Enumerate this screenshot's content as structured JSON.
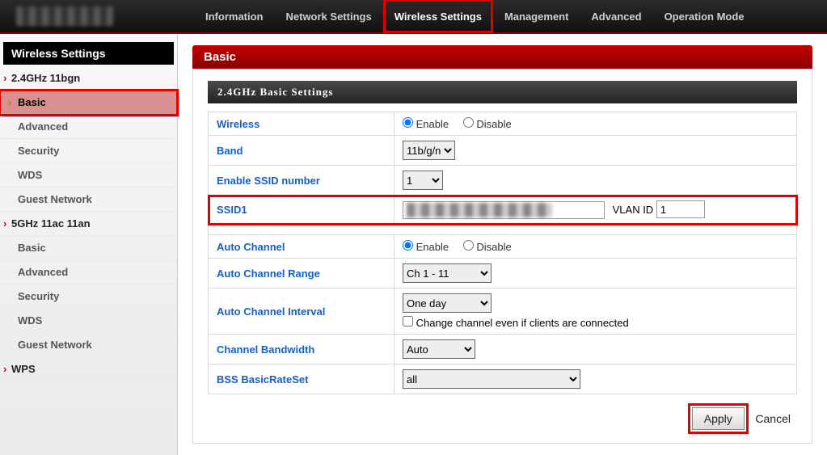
{
  "nav": {
    "items": [
      "Information",
      "Network Settings",
      "Wireless Settings",
      "Management",
      "Advanced",
      "Operation Mode"
    ],
    "activeIndex": 2
  },
  "sidebar": {
    "title": "Wireless Settings",
    "groups": [
      {
        "parent": "2.4GHz 11bgn",
        "items": [
          "Basic",
          "Advanced",
          "Security",
          "WDS",
          "Guest Network"
        ],
        "selectedIndex": 0
      },
      {
        "parent": "5GHz 11ac 11an",
        "items": [
          "Basic",
          "Advanced",
          "Security",
          "WDS",
          "Guest Network"
        ]
      },
      {
        "parent": "WPS",
        "items": []
      }
    ]
  },
  "panel": {
    "title": "Basic",
    "section": "2.4GHz Basic Settings"
  },
  "form": {
    "wireless_label": "Wireless",
    "enable_label": "Enable",
    "disable_label": "Disable",
    "band_label": "Band",
    "band_value": "11b/g/n",
    "enable_ssid_label": "Enable SSID number",
    "enable_ssid_value": "1",
    "ssid1_label": "SSID1",
    "ssid1_value": "",
    "vlan_label": "VLAN ID",
    "vlan_value": "1",
    "auto_channel_label": "Auto Channel",
    "auto_channel_range_label": "Auto Channel Range",
    "auto_channel_range_value": "Ch 1 - 11",
    "auto_channel_interval_label": "Auto Channel Interval",
    "auto_channel_interval_value": "One day",
    "change_channel_label": "Change channel even if clients are connected",
    "channel_bw_label": "Channel Bandwidth",
    "channel_bw_value": "Auto",
    "bss_label": "BSS BasicRateSet",
    "bss_value": "all"
  },
  "buttons": {
    "apply": "Apply",
    "cancel": "Cancel"
  }
}
